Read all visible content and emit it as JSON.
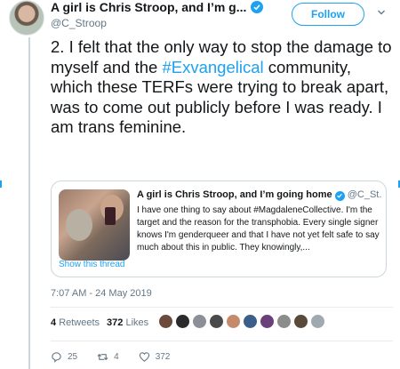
{
  "header": {
    "display_name": "A girl is Chris Stroop, and I’m g...",
    "handle": "@C_Stroop",
    "follow_label": "Follow"
  },
  "tweet": {
    "text_before": "2. I felt that the only way to stop the damage to myself and the ",
    "hashtag": "#Exvangelical",
    "text_after": " community, which these TERFs were trying to break apart, was to come out publicly before I was ready. I am trans feminine."
  },
  "quote": {
    "display_name": "A girl is Chris Stroop, and I’m going home",
    "handle": "@C_St...",
    "text": "I have one thing to say about #MagdaleneCollective. I'm the target and the reason for the transphobia. Every single signer knows I'm genderqueer and that I have not yet felt safe to say much about this in public. They knowingly,...",
    "show_thread": "Show this thread"
  },
  "timestamp": "7:07 AM - 24 May 2019",
  "stats": {
    "retweets_count": "4",
    "retweets_label": "Retweets",
    "likes_count": "372",
    "likes_label": "Likes"
  },
  "actions": {
    "replies": "25",
    "retweets": "4",
    "likes": "372"
  },
  "colors": {
    "accent": "#1da1f2",
    "liker_avatars": [
      "#6b4a3a",
      "#2b2b2b",
      "#8a8f98",
      "#4a4a4a",
      "#c58a6a",
      "#3b5f8a",
      "#6a3f7a",
      "#8c8c8c",
      "#5a4a3a",
      "#a0a8b0"
    ]
  },
  "icons": [
    "verified-icon",
    "chevron-down-icon",
    "reply-icon",
    "retweet-icon",
    "like-icon"
  ]
}
